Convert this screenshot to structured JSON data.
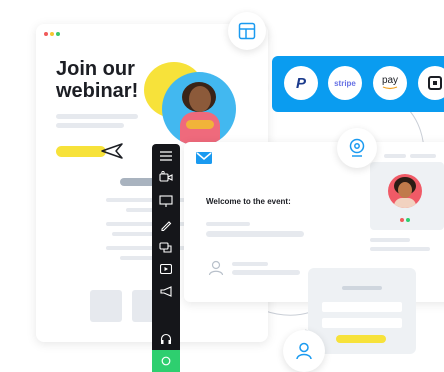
{
  "webinar_card": {
    "heading_line1": "Join our",
    "heading_line2": "webinar!"
  },
  "event_card": {
    "welcome_text": "Welcome to the event:"
  },
  "payment_bar": {
    "stripe_label": "stripe",
    "pay_label": "pay",
    "accent_color": "#0a9cf0"
  },
  "colors": {
    "yellow": "#f7e23a",
    "green": "#2ecf6f",
    "sidebar": "#15161a",
    "blue_accent": "#1a9af0"
  }
}
